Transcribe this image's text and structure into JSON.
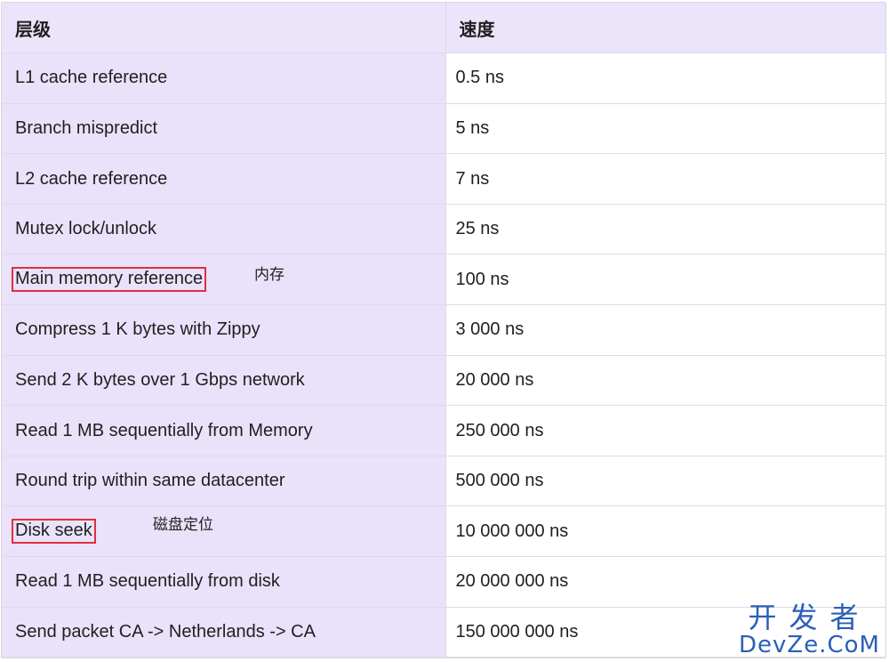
{
  "table": {
    "headers": [
      "层级",
      "速度"
    ],
    "rows": [
      {
        "level": "L1 cache reference",
        "speed": "0.5 ns"
      },
      {
        "level": "Branch mispredict",
        "speed": "5 ns"
      },
      {
        "level": "L2 cache reference",
        "speed": "7 ns"
      },
      {
        "level": "Mutex lock/unlock",
        "speed": "25 ns"
      },
      {
        "level": "Main memory reference",
        "speed": "100 ns",
        "highlighted": true,
        "note": "内存"
      },
      {
        "level": "Compress 1 K bytes with Zippy",
        "speed": "3 000 ns"
      },
      {
        "level": "Send 2 K bytes over 1 Gbps network",
        "speed": "20 000 ns"
      },
      {
        "level": "Read 1 MB sequentially from Memory",
        "speed": "250 000 ns"
      },
      {
        "level": "Round trip within same datacenter",
        "speed": "500 000 ns"
      },
      {
        "level": "Disk seek",
        "speed": "10 000 000 ns",
        "highlighted": true,
        "note": "磁盘定位"
      },
      {
        "level": "Read 1 MB sequentially from disk",
        "speed": "20 000 000 ns"
      },
      {
        "level": "Send packet CA -> Netherlands -> CA",
        "speed": "150 000 000 ns"
      }
    ]
  },
  "watermark": {
    "cn": "开发者",
    "en": "DevZe.CoM"
  },
  "colors": {
    "level_bg": "#e9e2fa",
    "header_bg": "#ebe4fb",
    "highlight_border": "#e0303d",
    "watermark": "#2a5fb8"
  }
}
